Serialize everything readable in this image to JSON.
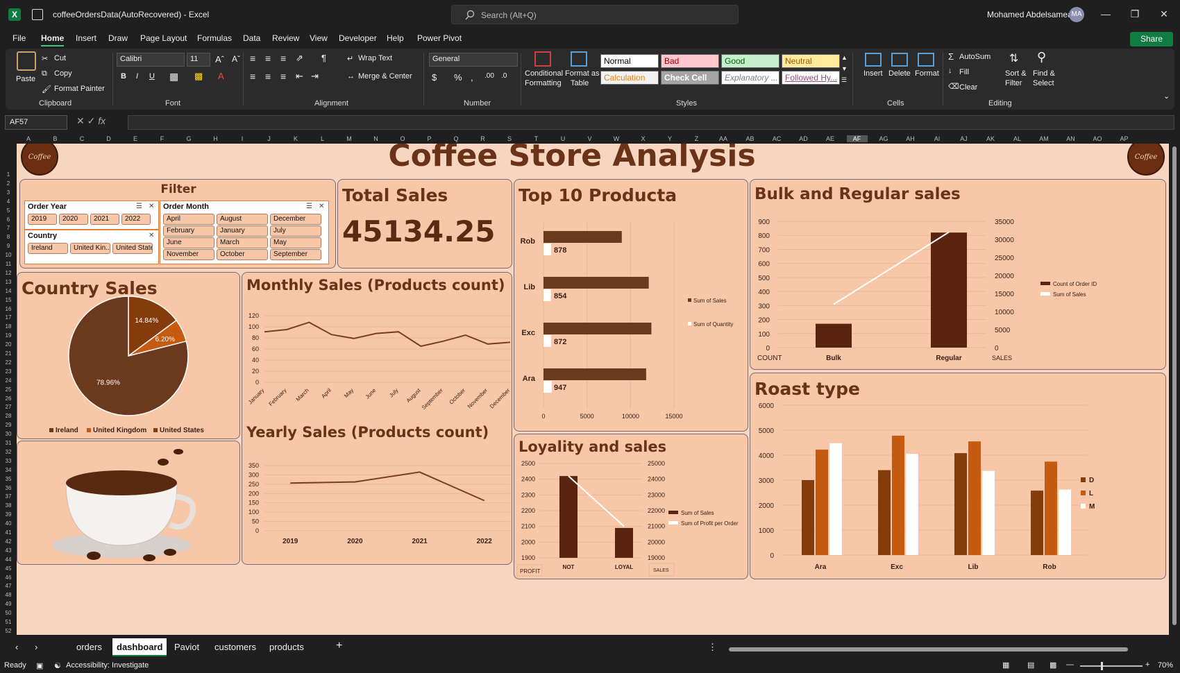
{
  "window": {
    "title": "coffeeOrdersData(AutoRecovered)  -  Excel",
    "search_placeholder": "Search (Alt+Q)",
    "user": "Mohamed Abdelsamea",
    "initials": "MA"
  },
  "menu": [
    "File",
    "Home",
    "Insert",
    "Draw",
    "Page Layout",
    "Formulas",
    "Data",
    "Review",
    "View",
    "Developer",
    "Help",
    "Power Pivot"
  ],
  "share_label": "Share",
  "ribbon": {
    "clipboard": {
      "paste": "Paste",
      "cut": "Cut",
      "copy": "Copy",
      "format_painter": "Format Painter",
      "label": "Clipboard"
    },
    "font": {
      "name": "Calibri",
      "size": "11",
      "label": "Font"
    },
    "alignment": {
      "wrap": "Wrap Text",
      "merge": "Merge & Center",
      "label": "Alignment"
    },
    "number": {
      "format": "General",
      "label": "Number"
    },
    "styles": {
      "conditional": "Conditional",
      "formatting": "Formatting",
      "format_as": "Format as",
      "table": "Table",
      "label": "Styles",
      "cells": [
        {
          "text": "Normal",
          "bg": "#ffffff",
          "fg": "#000000"
        },
        {
          "text": "Bad",
          "bg": "#ffc7ce",
          "fg": "#9c0006"
        },
        {
          "text": "Good",
          "bg": "#c6efce",
          "fg": "#006100"
        },
        {
          "text": "Neutral",
          "bg": "#ffeb9c",
          "fg": "#9c5700"
        },
        {
          "text": "Calculation",
          "bg": "#f2f2f2",
          "fg": "#fa7d00"
        },
        {
          "text": "Check Cell",
          "bg": "#a5a5a5",
          "fg": "#ffffff"
        },
        {
          "text": "Explanatory ...",
          "bg": "#ffffff",
          "fg": "#7f7f7f"
        },
        {
          "text": "Followed Hy...",
          "bg": "#ffffff",
          "fg": "#954f72"
        }
      ]
    },
    "cells": {
      "insert": "Insert",
      "delete": "Delete",
      "format": "Format",
      "label": "Cells"
    },
    "editing": {
      "autosum": "AutoSum",
      "fill": "Fill",
      "clear": "Clear",
      "sort": "Sort &",
      "filter": "Filter",
      "find": "Find &",
      "select": "Select",
      "label": "Editing"
    }
  },
  "namebox": "AF57",
  "columns": [
    "A",
    "B",
    "C",
    "D",
    "E",
    "F",
    "G",
    "H",
    "I",
    "J",
    "K",
    "L",
    "M",
    "N",
    "O",
    "P",
    "Q",
    "R",
    "S",
    "T",
    "U",
    "V",
    "W",
    "X",
    "Y",
    "Z",
    "AA",
    "AB",
    "AC",
    "AD",
    "AE",
    "AF",
    "AG",
    "AH",
    "AI",
    "AJ",
    "AK",
    "AL",
    "AM",
    "AN",
    "AO",
    "AP"
  ],
  "dashboard": {
    "title": "Coffee Store Analysis",
    "logo_text": "Coffee",
    "filter": {
      "title": "Filter",
      "order_year": {
        "label": "Order Year",
        "items": [
          "2019",
          "2020",
          "2021",
          "2022"
        ]
      },
      "order_month": {
        "label": "Order Month",
        "items": [
          "April",
          "August",
          "December",
          "February",
          "January",
          "July",
          "June",
          "March",
          "May",
          "November",
          "October",
          "September"
        ]
      },
      "country": {
        "label": "Country",
        "items": [
          "Ireland",
          "United Kin...",
          "United States"
        ]
      }
    },
    "total_sales": {
      "title": "Total Sales",
      "value": "45134.25"
    },
    "top10": {
      "title": "Top 10 Producta"
    },
    "bulk": {
      "title": "Bulk and Regular sales",
      "left_label": "COUNT",
      "right_label": "SALES"
    },
    "country_sales": {
      "title": "Country Sales"
    },
    "monthly": {
      "title": "Monthly Sales (Products count)"
    },
    "yearly": {
      "title": "Yearly Sales (Products count)"
    },
    "loyalty": {
      "title": "Loyality and sales",
      "left_label": "PROFIT",
      "right_label": "SALES"
    },
    "roast": {
      "title": "Roast type"
    }
  },
  "chart_data": [
    {
      "type": "bar",
      "orientation": "horizontal",
      "categories": [
        "Rob",
        "Lib",
        "Exc",
        "Ara"
      ],
      "series": [
        {
          "name": "Sum of Sales",
          "values": [
            9000,
            12100,
            12400,
            11800
          ],
          "color": "#6b3a1e"
        },
        {
          "name": "Sum of Quantity",
          "values": [
            878,
            854,
            872,
            947
          ],
          "color": "#ffffff"
        }
      ],
      "xlim": [
        0,
        15000
      ],
      "xticks": [
        0,
        5000,
        10000,
        15000
      ],
      "data_labels": [
        "878",
        "854",
        "872",
        "947"
      ]
    },
    {
      "type": "bar",
      "categories": [
        "Bulk",
        "Regular"
      ],
      "series": [
        {
          "name": "Count of Order ID",
          "values": [
            170,
            820
          ],
          "axis": "left",
          "color": "#5a2410"
        },
        {
          "name": "Sum of Sales",
          "values": [
            12000,
            32000
          ],
          "axis": "right",
          "type": "line",
          "color": "#ffffff"
        }
      ],
      "ylim": [
        0,
        900
      ],
      "y2lim": [
        0,
        35000
      ],
      "yticks": [
        0,
        100,
        200,
        300,
        400,
        500,
        600,
        700,
        800,
        900
      ],
      "y2ticks": [
        0,
        5000,
        10000,
        15000,
        20000,
        25000,
        30000,
        35000
      ]
    },
    {
      "type": "pie",
      "categories": [
        "Ireland",
        "United Kingdom",
        "United States"
      ],
      "values": [
        78.96,
        6.2,
        14.84
      ],
      "labels": [
        "78.96%",
        "6.20%",
        "14.84%"
      ],
      "colors": [
        "#6b3a1e",
        "#c55a11",
        "#843c0c"
      ]
    },
    {
      "type": "line",
      "categories": [
        "January",
        "February",
        "March",
        "April",
        "May",
        "June",
        "July",
        "August",
        "September",
        "October",
        "November",
        "December"
      ],
      "values": [
        91,
        95,
        108,
        86,
        79,
        88,
        91,
        65,
        74,
        85,
        69,
        72
      ],
      "ylim": [
        0,
        120
      ],
      "yticks": [
        0,
        20,
        40,
        60,
        80,
        100,
        120
      ]
    },
    {
      "type": "line",
      "categories": [
        "2019",
        "2020",
        "2021",
        "2022"
      ],
      "values": [
        256,
        262,
        315,
        162
      ],
      "ylim": [
        0,
        350
      ],
      "yticks": [
        0,
        50,
        100,
        150,
        200,
        250,
        300,
        350
      ]
    },
    {
      "type": "bar",
      "categories": [
        "NOT",
        "LOYAL"
      ],
      "series": [
        {
          "name": "Sum of Sales",
          "values": [
            2420,
            2090
          ],
          "axis": "left",
          "color": "#5a2410"
        },
        {
          "name": "Sum of Profit per Order",
          "values": [
            24200,
            21000
          ],
          "axis": "right",
          "type": "line",
          "color": "#ffffff"
        }
      ],
      "ylim": [
        1900,
        2500
      ],
      "y2lim": [
        19000,
        25000
      ],
      "yticks": [
        1900,
        2000,
        2100,
        2200,
        2300,
        2400,
        2500
      ],
      "y2ticks": [
        19000,
        20000,
        21000,
        22000,
        23000,
        24000,
        25000
      ]
    },
    {
      "type": "bar",
      "categories": [
        "Ara",
        "Exc",
        "Lib",
        "Rob"
      ],
      "series": [
        {
          "name": "D",
          "values": [
            3000,
            3400,
            4080,
            2580
          ],
          "color": "#843c0c"
        },
        {
          "name": "L",
          "values": [
            4220,
            4780,
            4550,
            3740
          ],
          "color": "#c55a11"
        },
        {
          "name": "M",
          "values": [
            4480,
            4050,
            3370,
            2620
          ],
          "color": "#ffffff"
        }
      ],
      "ylim": [
        0,
        6000
      ],
      "yticks": [
        0,
        1000,
        2000,
        3000,
        4000,
        5000,
        6000
      ]
    }
  ],
  "sheets": [
    "orders",
    "dashboard",
    "Paviot",
    "customers",
    "products"
  ],
  "status": {
    "ready": "Ready",
    "accessibility": "Accessibility: Investigate",
    "zoom": "70%"
  }
}
